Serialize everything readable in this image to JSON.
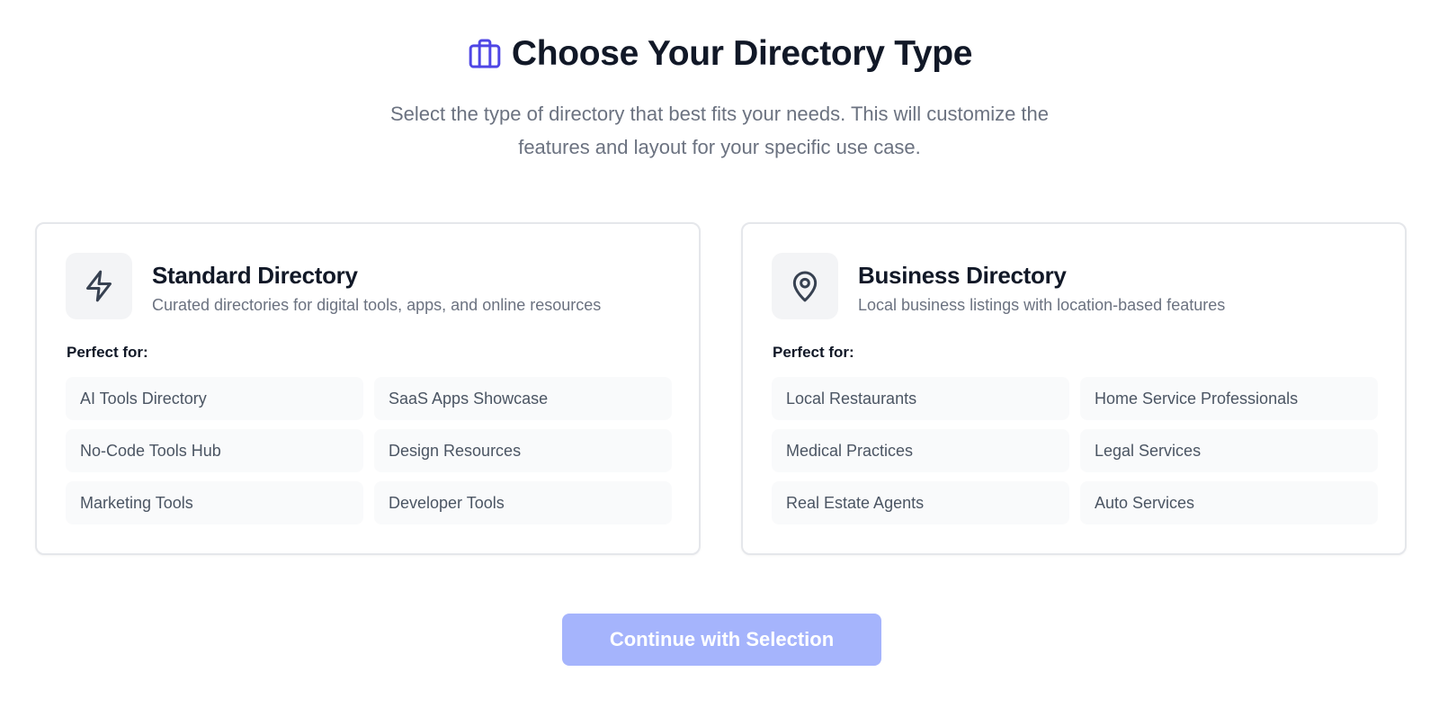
{
  "header": {
    "icon": "briefcase-icon",
    "title": "Choose Your Directory Type",
    "subtitle_line1": "Select the type of directory that best fits your needs. This will customize the",
    "subtitle_line2": "features and layout for your specific use case."
  },
  "cards": [
    {
      "icon": "lightning-icon",
      "title": "Standard Directory",
      "description": "Curated directories for digital tools, apps, and online resources",
      "perfect_for_label": "Perfect for:",
      "tags": [
        "AI Tools Directory",
        "SaaS Apps Showcase",
        "No-Code Tools Hub",
        "Design Resources",
        "Marketing Tools",
        "Developer Tools"
      ]
    },
    {
      "icon": "map-pin-icon",
      "title": "Business Directory",
      "description": "Local business listings with location-based features",
      "perfect_for_label": "Perfect for:",
      "tags": [
        "Local Restaurants",
        "Home Service Professionals",
        "Medical Practices",
        "Legal Services",
        "Real Estate Agents",
        "Auto Services"
      ]
    }
  ],
  "continue_button": {
    "label": "Continue with Selection",
    "state": "disabled"
  },
  "colors": {
    "accent": "#4f46e5",
    "button_disabled": "#a5b4fc",
    "title_text": "#111827",
    "muted_text": "#6b7280",
    "card_border": "#e5e7eb",
    "tag_background": "#f9fafb"
  }
}
